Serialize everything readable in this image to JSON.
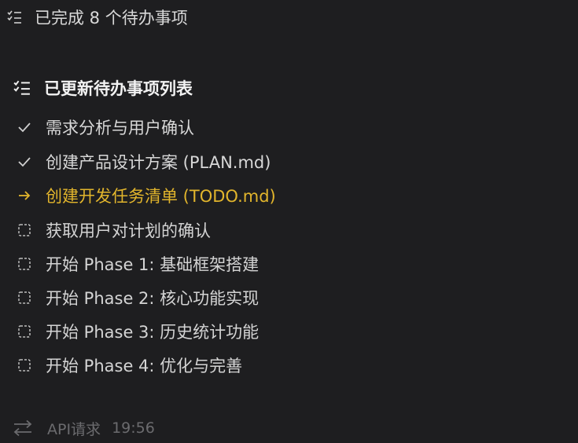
{
  "summary": {
    "text": "已完成 8 个待办事项"
  },
  "header": {
    "title": "已更新待办事项列表"
  },
  "tasks": [
    {
      "label": "需求分析与用户确认",
      "status": "done"
    },
    {
      "label": "创建产品设计方案 (PLAN.md)",
      "status": "done"
    },
    {
      "label": "创建开发任务清单 (TODO.md)",
      "status": "active"
    },
    {
      "label": "获取用户对计划的确认",
      "status": "pending"
    },
    {
      "label": "开始 Phase 1: 基础框架搭建",
      "status": "pending"
    },
    {
      "label": "开始 Phase 2: 核心功能实现",
      "status": "pending"
    },
    {
      "label": "开始 Phase 3: 历史统计功能",
      "status": "pending"
    },
    {
      "label": "开始 Phase 4: 优化与完善",
      "status": "pending"
    }
  ],
  "footer": {
    "label": "API请求",
    "time": "19:56"
  },
  "colors": {
    "background": "#1e1e20",
    "active": "#e2b52c",
    "text": "#dcdcdc",
    "muted": "#6b6b6e"
  }
}
